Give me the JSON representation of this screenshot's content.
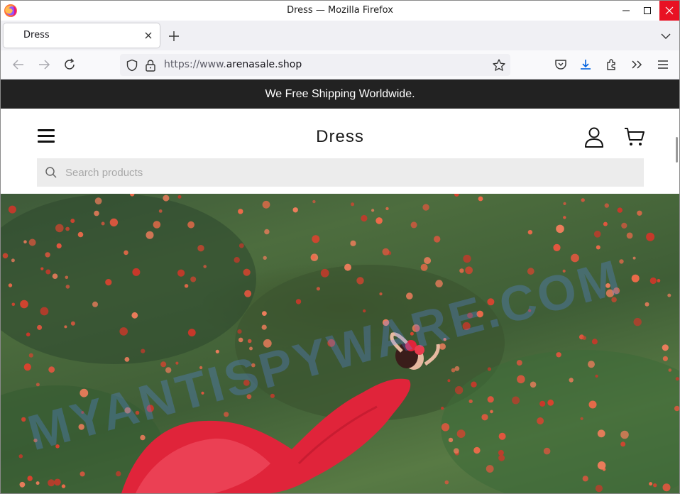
{
  "window": {
    "title": "Dress — Mozilla Firefox"
  },
  "tabs": [
    {
      "label": "Dress",
      "active": true
    }
  ],
  "navbar": {
    "url_prefix": "https://www.",
    "url_domain": "arenasale.shop"
  },
  "site": {
    "announcement": "We Free Shipping Worldwide.",
    "brand": "Dress",
    "search_placeholder": "Search products"
  },
  "hero": {
    "alt": "Woman in red dress lying in a field of poppies"
  },
  "watermark": "MYANTISPYWARE.COM",
  "icons": {
    "browser_logo": "firefox-logo-icon",
    "account": "user-icon",
    "cart": "cart-icon",
    "search": "search-icon"
  },
  "colors": {
    "announcement_bg": "#222222",
    "close_button": "#e81123",
    "dress_red": "#e0243a"
  }
}
